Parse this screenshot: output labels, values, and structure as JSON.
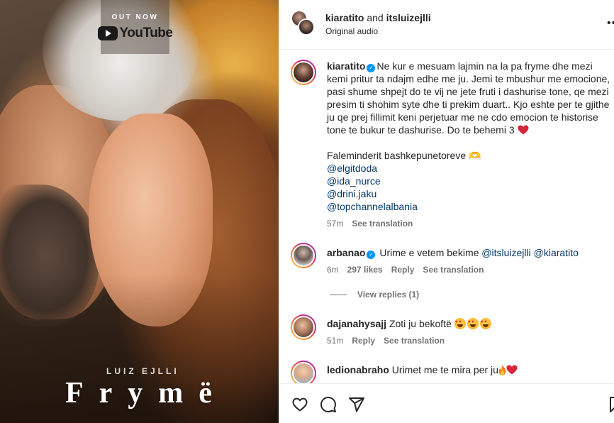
{
  "media": {
    "badge": {
      "out_now": "OUT NOW",
      "platform": "YouTube"
    },
    "artist": "LUIZ EJLLI",
    "title": "Frymë"
  },
  "header": {
    "author": "kiaratito",
    "and_text": " and ",
    "collaborator": "itsluizejlli",
    "audio": "Original audio",
    "more": "•••"
  },
  "caption": {
    "username": "kiaratito",
    "lines": [
      "Ne kur e mesuam lajmin na la pa fryme dhe mezi",
      "kemi pritur ta ndajm edhe me ju. Jemi te mbushur me emocione,",
      "pasi shume shpejt do te vij ne jete fruti i dashurise tone, qe mezi",
      "presim ti shohim syte dhe ti prekim duart.. Kjo eshte per te gjithe",
      "ju qe prej fillimit keni perjetuar me ne cdo emocion te historise",
      "tone te bukur te dashurise. Do te behemi 3"
    ],
    "thanks": "Faleminderit bashkepunetoreve 🫶",
    "mentions": [
      "@elgitdoda",
      "@ida_nurce",
      "@drini.jaku",
      "@topchannelalbania"
    ],
    "time": "57m",
    "see_translation": "See translation"
  },
  "comments": [
    {
      "username": "arbanao",
      "text": "Urime e vetem bekime ",
      "mention1": "@itsluizejlli",
      "mention2": "@kiaratito",
      "time": "6m",
      "likes": "297 likes",
      "reply": "Reply",
      "see_translation": "See translation",
      "view_replies": "View replies (1)"
    },
    {
      "username": "dajanahysajj",
      "text": "Zoti ju bekoftë ",
      "time": "51m",
      "reply": "Reply",
      "see_translation": "See translation"
    },
    {
      "username": "ledionabraho",
      "text": "Urimet me te mira per ju"
    }
  ],
  "colors": {
    "link": "#00376b",
    "verified": "#0095f6",
    "muted": "#737373",
    "text": "#262626"
  }
}
